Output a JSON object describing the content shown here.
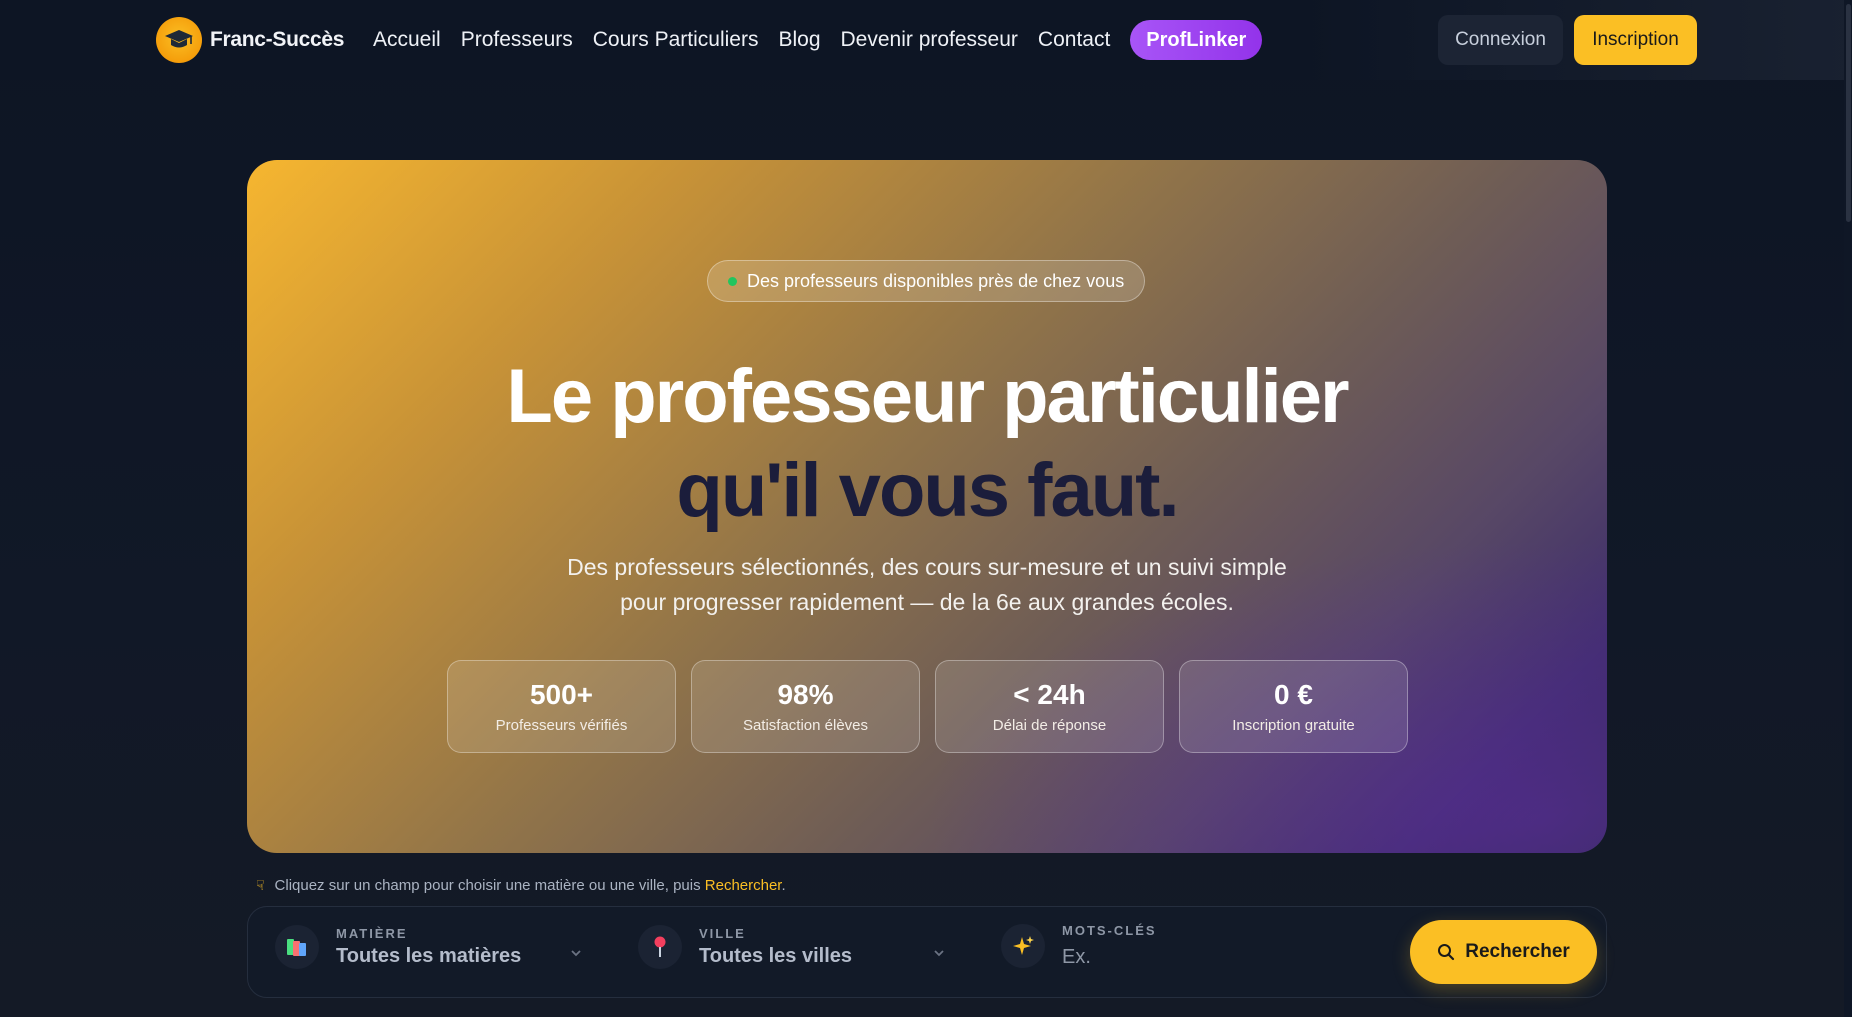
{
  "nav": {
    "logo_text": "Franc-Succès",
    "links": [
      "Accueil",
      "Professeurs",
      "Cours Particuliers",
      "Blog",
      "Devenir professeur",
      "Contact"
    ],
    "highlight_link": "ProfLinker",
    "login_label": "Connexion",
    "signup_label": "Inscription"
  },
  "hero": {
    "badge": "Des professeurs disponibles près de chez vous",
    "title_line1": "Le professeur particulier",
    "title_line2": "qu'il vous faut.",
    "subtitle_line1": "Des professeurs sélectionnés, des cours sur-mesure et un suivi simple",
    "subtitle_line2": "pour progresser rapidement — de la 6e aux grandes écoles.",
    "stats": [
      {
        "value": "500+",
        "label": "Professeurs vérifiés"
      },
      {
        "value": "98%",
        "label": "Satisfaction élèves"
      },
      {
        "value": "< 24h",
        "label": "Délai de réponse"
      },
      {
        "value": "0 €",
        "label": "Inscription gratuite"
      }
    ]
  },
  "hint": {
    "text": "Cliquez sur un champ pour choisir une matière ou une ville, puis",
    "link": "Rechercher",
    "end": "."
  },
  "search": {
    "subject_label": "MATIÈRE",
    "subject_value": "Toutes les matières",
    "city_label": "VILLE",
    "city_value": "Toutes les villes",
    "keywords_label": "MOTS-CLÉS",
    "keywords_placeholder": "Ex.",
    "button_label": "Rechercher"
  },
  "colors": {
    "accent": "#fbbf24",
    "purple": "#a855f7",
    "background": "#0e1626"
  },
  "icons": [
    "graduation-cap-icon",
    "books-icon",
    "pin-icon",
    "sparkles-icon",
    "search-icon",
    "pointing-hand-icon",
    "chevron-down-icon"
  ]
}
